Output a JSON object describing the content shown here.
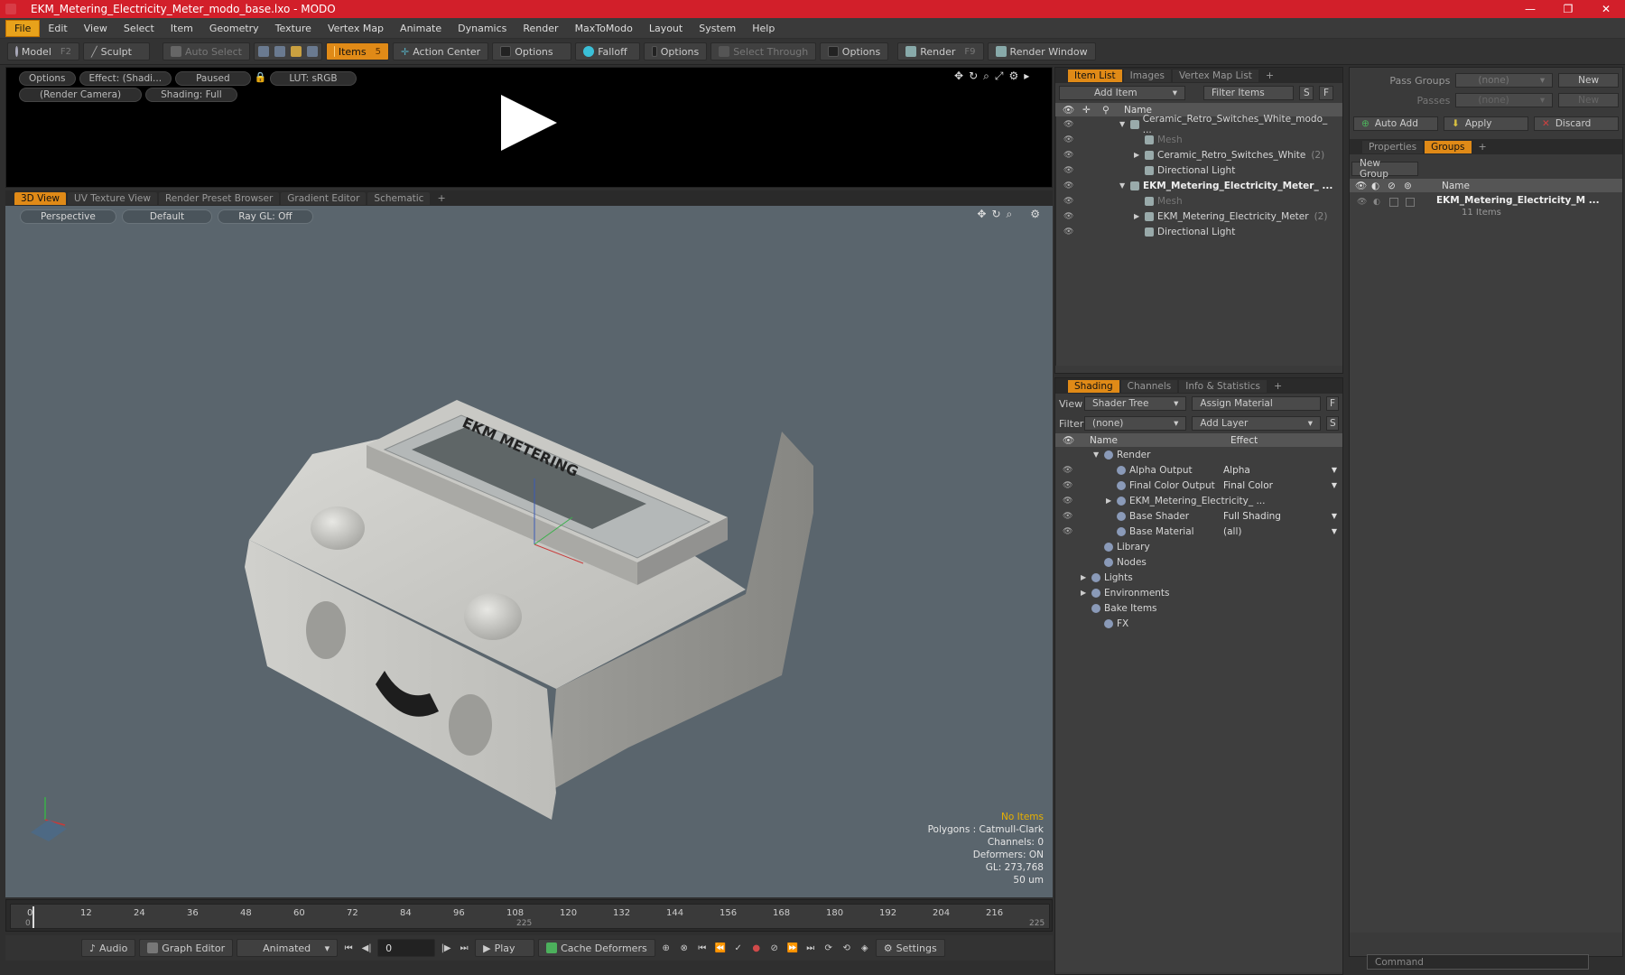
{
  "window": {
    "title": "EKM_Metering_Electricity_Meter_modo_base.lxo - MODO"
  },
  "menu": [
    "File",
    "Edit",
    "View",
    "Select",
    "Item",
    "Geometry",
    "Texture",
    "Vertex Map",
    "Animate",
    "Dynamics",
    "Render",
    "MaxToModo",
    "Layout",
    "System",
    "Help"
  ],
  "toolbar": {
    "model": "Model",
    "model_key": "F2",
    "sculpt": "Sculpt",
    "auto_select": "Auto Select",
    "items": "Items",
    "items_key": "5",
    "action_center": "Action Center",
    "options1": "Options",
    "falloff": "Falloff",
    "options2": "Options",
    "select_through": "Select Through",
    "options3": "Options",
    "render": "Render",
    "render_key": "F9",
    "render_window": "Render Window"
  },
  "render_view": {
    "options": "Options",
    "effect": "Effect: (Shadi...",
    "paused": "Paused",
    "lut": "LUT: sRGB",
    "camera": "(Render Camera)",
    "shading": "Shading: Full"
  },
  "view_tabs": [
    "3D View",
    "UV Texture View",
    "Render Preset Browser",
    "Gradient Editor",
    "Schematic"
  ],
  "viewport": {
    "perspective": "Perspective",
    "default": "Default",
    "raygl": "Ray GL: Off",
    "meter_brand": "EKM METERING",
    "stats": {
      "no_items": "No Items",
      "polygons": "Polygons : Catmull-Clark",
      "channels": "Channels: 0",
      "deformers": "Deformers: ON",
      "gl": "GL: 273,768",
      "scale": "50 um"
    }
  },
  "timeline": {
    "ticks": [
      "0",
      "12",
      "24",
      "36",
      "48",
      "60",
      "72",
      "84",
      "96",
      "108",
      "120",
      "132",
      "144",
      "156",
      "168",
      "180",
      "192",
      "204",
      "216"
    ],
    "sub_ticks": [
      "0",
      "225",
      "225"
    ]
  },
  "bottom": {
    "audio": "Audio",
    "graph_editor": "Graph Editor",
    "animated": "Animated",
    "frame": "0",
    "play": "Play",
    "cache_deformers": "Cache Deformers",
    "settings": "Settings"
  },
  "item_list": {
    "tabs": [
      "Item List",
      "Images",
      "Vertex Map List"
    ],
    "add_item": "Add Item",
    "filter_items": "Filter Items",
    "s": "S",
    "f": "F",
    "col_name": "Name",
    "rows": [
      {
        "label": "Ceramic_Retro_Switches_White_modo_ ...",
        "indent": 0,
        "tri": "▼",
        "style": "normal",
        "count": ""
      },
      {
        "label": "Mesh",
        "indent": 1,
        "tri": "",
        "style": "dim",
        "count": ""
      },
      {
        "label": "Ceramic_Retro_Switches_White",
        "indent": 1,
        "tri": "▶",
        "style": "normal",
        "count": "(2)"
      },
      {
        "label": "Directional Light",
        "indent": 1,
        "tri": "",
        "style": "normal",
        "count": ""
      },
      {
        "label": "EKM_Metering_Electricity_Meter_ ...",
        "indent": 0,
        "tri": "▼",
        "style": "bold",
        "count": ""
      },
      {
        "label": "Mesh",
        "indent": 1,
        "tri": "",
        "style": "dim",
        "count": ""
      },
      {
        "label": "EKM_Metering_Electricity_Meter",
        "indent": 1,
        "tri": "▶",
        "style": "normal",
        "count": "(2)"
      },
      {
        "label": "Directional Light",
        "indent": 1,
        "tri": "",
        "style": "normal",
        "count": ""
      }
    ]
  },
  "shading": {
    "tabs": [
      "Shading",
      "Channels",
      "Info & Statistics"
    ],
    "view_label": "View",
    "view_value": "Shader Tree",
    "assign_material": "Assign Material",
    "filter_label": "Filter",
    "filter_value": "(none)",
    "add_layer": "Add Layer",
    "col_name": "Name",
    "col_effect": "Effect",
    "rows": [
      {
        "label": "Render",
        "indent": 0,
        "tri": "▼",
        "effect": "",
        "eye": false
      },
      {
        "label": "Alpha Output",
        "indent": 1,
        "tri": "",
        "effect": "Alpha",
        "eye": true
      },
      {
        "label": "Final Color Output",
        "indent": 1,
        "tri": "",
        "effect": "Final Color",
        "eye": true
      },
      {
        "label": "EKM_Metering_Electricity_ ...",
        "indent": 1,
        "tri": "▶",
        "effect": "",
        "eye": true
      },
      {
        "label": "Base Shader",
        "indent": 1,
        "tri": "",
        "effect": "Full Shading",
        "eye": true
      },
      {
        "label": "Base Material",
        "indent": 1,
        "tri": "",
        "effect": "(all)",
        "eye": true
      },
      {
        "label": "Library",
        "indent": 0,
        "tri": "",
        "effect": "",
        "eye": false
      },
      {
        "label": "Nodes",
        "indent": 0,
        "tri": "",
        "effect": "",
        "eye": false
      },
      {
        "label": "Lights",
        "indent": -1,
        "tri": "▶",
        "effect": "",
        "eye": false
      },
      {
        "label": "Environments",
        "indent": -1,
        "tri": "▶",
        "effect": "",
        "eye": false
      },
      {
        "label": "Bake Items",
        "indent": -1,
        "tri": "",
        "effect": "",
        "eye": false
      },
      {
        "label": "FX",
        "indent": 0,
        "tri": "",
        "effect": "",
        "eye": false
      }
    ]
  },
  "groups": {
    "pass_groups_label": "Pass Groups",
    "pass_groups_value": "(none)",
    "new": "New",
    "passes_label": "Passes",
    "passes_value": "(none)",
    "new2": "New",
    "auto_add": "Auto Add",
    "apply": "Apply",
    "discard": "Discard",
    "tabs": [
      "Properties",
      "Groups"
    ],
    "new_group": "New Group",
    "col_name": "Name",
    "group_name": "EKM_Metering_Electricity_M ...",
    "group_count": "11 Items"
  },
  "command": {
    "placeholder": "Command"
  }
}
